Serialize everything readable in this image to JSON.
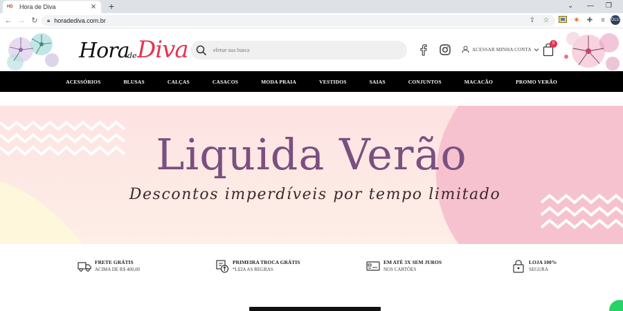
{
  "browser": {
    "tab_title": "Hora de Diva",
    "favicon_text": "HD",
    "url": "horadediva.com.br",
    "new_tab": "+",
    "profile_initials": "DLU"
  },
  "header": {
    "logo": {
      "part1": "Hora",
      "part2": "de",
      "part3": "Diva"
    },
    "search_placeholder": "efetue sua busca",
    "account_label": "ACESSAR MINHA CONTA",
    "cart_count": "0"
  },
  "nav": {
    "items": [
      "ACESSÓRIOS",
      "BLUSAS",
      "CALÇAS",
      "CASACOS",
      "MODA PRAIA",
      "VESTIDOS",
      "SAIAS",
      "CONJUNTOS",
      "MACACÃO",
      "PROMO VERÃO"
    ]
  },
  "banner": {
    "title": "Liquida Verão",
    "subtitle": "Descontos imperdíveis por tempo limitado"
  },
  "benefits": [
    {
      "title": "FRETE GRÁTIS",
      "sub": "ACIMA DE R$ 400,00"
    },
    {
      "title": "PRIMEIRA TROCA GRÁTIS",
      "sub": "*LEIA AS REGRAS"
    },
    {
      "title": "EM ATÉ 3X SEM JUROS",
      "sub": "NOS CARTÕES"
    },
    {
      "title": "LOJA 100%",
      "sub": "SEGURA"
    }
  ],
  "colors": {
    "brand_pink": "#e6344f",
    "banner_title": "#7a5080",
    "nav_bg": "#000000",
    "banner_bg": "#fce0e0"
  }
}
